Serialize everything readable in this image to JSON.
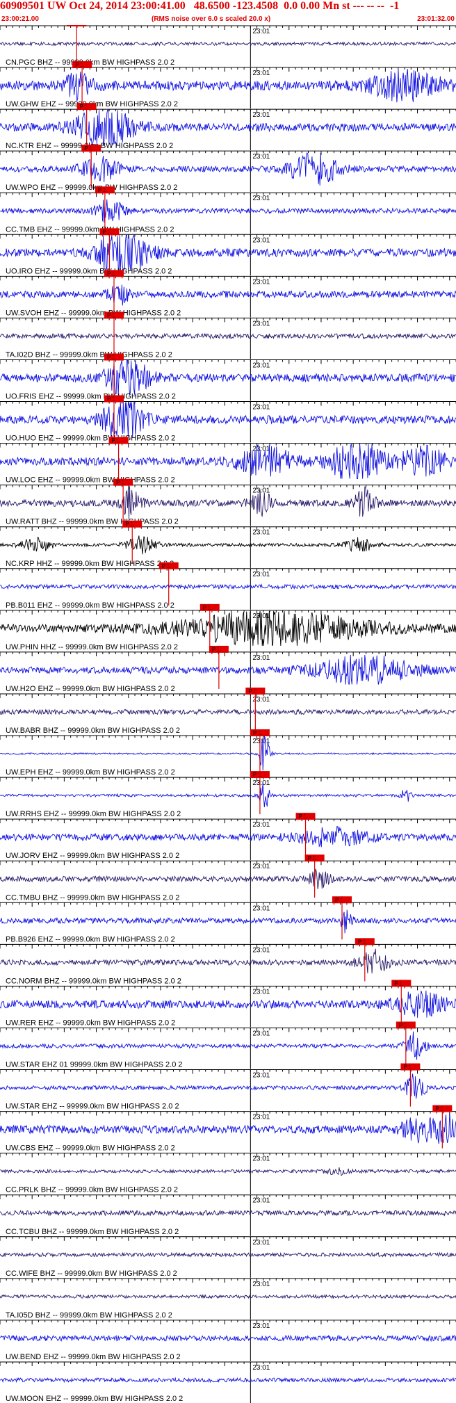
{
  "header": {
    "title": "60909501 UW Oct 24, 2014 23:00:41.00   48.6500 -123.4508  0.0 0.00 Mn st --- -- --  -1",
    "start_time": "23:00:21.00",
    "note": "(RMS noise over 6.0 s scaled 20.0 x)",
    "end_time": "23:01:32.00"
  },
  "colors": {
    "trace_blue": "#1010e0",
    "trace_navy": "#2a1a6a",
    "trace_black": "#000000",
    "pick": "#e00000",
    "grid": "#000000"
  },
  "chart_data": {
    "type": "seismogram",
    "time_axis": {
      "start": "23:00:21.00",
      "end": "23:01:32.00",
      "minute_label": "23:01"
    },
    "pick_label": "P 1",
    "channels": [
      {
        "label": "CN.PGC BHZ -- 99999.0km BW  HIGHPASS  2.0  2",
        "color": "navy",
        "noise": 0.12,
        "pick": 0.168,
        "events": []
      },
      {
        "label": "UW.GHW EHZ -- 99999.0km BW  HIGHPASS  2.0  2",
        "color": "blue",
        "noise": 0.35,
        "pick": 0.18,
        "events": [
          {
            "t": 0.17,
            "w": 0.03,
            "a": 0.8
          },
          {
            "t": 0.89,
            "w": 0.07,
            "a": 1.0
          }
        ]
      },
      {
        "label": "NC.KTR EHZ -- 99999.0km BW  HIGHPASS  2.0  2",
        "color": "blue",
        "noise": 0.3,
        "pick": 0.19,
        "events": [
          {
            "t": 0.23,
            "w": 0.06,
            "a": 1.4
          }
        ]
      },
      {
        "label": "UW.WPO EHZ -- 99999.0km BW  HIGHPASS  2.0  2",
        "color": "blue",
        "noise": 0.22,
        "pick": 0.2,
        "events": [
          {
            "t": 0.22,
            "w": 0.04,
            "a": 0.8
          },
          {
            "t": 0.69,
            "w": 0.05,
            "a": 1.1
          }
        ]
      },
      {
        "label": "CC.TMB EHZ -- 99999.0km BW  HIGHPASS  2.0  2",
        "color": "blue",
        "noise": 0.18,
        "pick": 0.23,
        "events": [
          {
            "t": 0.24,
            "w": 0.03,
            "a": 0.8
          }
        ]
      },
      {
        "label": "UO.IRO EHZ -- 99999.0km BW  HIGHPASS  2.0  2",
        "color": "blue",
        "noise": 0.3,
        "pick": 0.24,
        "events": [
          {
            "t": 0.27,
            "w": 0.05,
            "a": 2.0
          }
        ]
      },
      {
        "label": "UW.SVOH EHZ -- 99999.0km BW  HIGHPASS  2.0  2",
        "color": "blue",
        "noise": 0.25,
        "pick": 0.25,
        "events": [
          {
            "t": 0.26,
            "w": 0.02,
            "a": 0.7
          }
        ]
      },
      {
        "label": "TA.I02D BHZ -- 99999.0km BW  HIGHPASS  2.0  2",
        "color": "navy",
        "noise": 0.18,
        "pick": 0.25,
        "events": []
      },
      {
        "label": "UO.FRIS EHZ -- 99999.0km BW  HIGHPASS  2.0  2",
        "color": "blue",
        "noise": 0.3,
        "pick": 0.25,
        "events": [
          {
            "t": 0.28,
            "w": 0.04,
            "a": 1.6
          }
        ]
      },
      {
        "label": "UO.HUO EHZ -- 99999.0km BW  HIGHPASS  2.0  2",
        "color": "blue",
        "noise": 0.3,
        "pick": 0.25,
        "events": [
          {
            "t": 0.27,
            "w": 0.04,
            "a": 1.6
          }
        ]
      },
      {
        "label": "UW.LOC EHZ -- 99999.0km BW  HIGHPASS  2.0  2",
        "color": "blue",
        "noise": 0.3,
        "pick": 0.26,
        "events": [
          {
            "t": 0.58,
            "w": 0.06,
            "a": 1.0
          },
          {
            "t": 0.78,
            "w": 0.05,
            "a": 1.6
          },
          {
            "t": 0.93,
            "w": 0.05,
            "a": 1.0
          }
        ]
      },
      {
        "label": "UW.RATT BHZ -- 99999.0km BW  HIGHPASS  2.0  2",
        "color": "navy",
        "noise": 0.25,
        "pick": 0.27,
        "events": [
          {
            "t": 0.29,
            "w": 0.02,
            "a": 1.2
          },
          {
            "t": 0.57,
            "w": 0.02,
            "a": 1.1
          },
          {
            "t": 0.8,
            "w": 0.02,
            "a": 1.0
          }
        ]
      },
      {
        "label": "NC.KRP HHZ -- 99999.0km BW  HIGHPASS  2.0  2",
        "color": "black",
        "noise": 0.12,
        "pick": 0.29,
        "events": [
          {
            "t": 0.08,
            "w": 0.03,
            "a": 0.5
          },
          {
            "t": 0.31,
            "w": 0.03,
            "a": 0.6
          },
          {
            "t": 0.79,
            "w": 0.03,
            "a": 0.5
          }
        ]
      },
      {
        "label": "PB.B011 EHZ -- 99999.0km BW  HIGHPASS  2.0  2",
        "color": "blue",
        "noise": 0.15,
        "pick": 0.37,
        "events": []
      },
      {
        "label": "UW.PHIN HHZ -- 99999.0km BW  HIGHPASS  2.0  2",
        "color": "black",
        "noise": 0.3,
        "pick": 0.46,
        "events": [
          {
            "t": 0.6,
            "w": 0.18,
            "a": 1.2
          }
        ]
      },
      {
        "label": "UW.H2O EHZ -- 99999.0km BW  HIGHPASS  2.0  2",
        "color": "blue",
        "noise": 0.25,
        "pick": 0.48,
        "events": [
          {
            "t": 0.8,
            "w": 0.1,
            "a": 1.0
          }
        ]
      },
      {
        "label": "UW.BABR BHZ -- 99999.0km BW  HIGHPASS  2.0  2",
        "color": "navy",
        "noise": 0.18,
        "pick": 0.56,
        "events": []
      },
      {
        "label": "UW.EPH EHZ -- 99999.0km BW  HIGHPASS  2.0  2",
        "color": "blue",
        "noise": 0.06,
        "pick": 0.57,
        "events": [
          {
            "t": 0.58,
            "w": 0.01,
            "a": 1.5
          }
        ]
      },
      {
        "label": "UW.RRHS EHZ -- 99999.0km BW  HIGHPASS  2.0  2",
        "color": "blue",
        "noise": 0.1,
        "pick": 0.57,
        "events": [
          {
            "t": 0.58,
            "w": 0.01,
            "a": 1.0
          },
          {
            "t": 0.89,
            "w": 0.01,
            "a": 0.5
          }
        ]
      },
      {
        "label": "UW.JORV EHZ -- 99999.0km BW  HIGHPASS  2.0  2",
        "color": "blue",
        "noise": 0.25,
        "pick": 0.67,
        "events": [
          {
            "t": 0.73,
            "w": 0.07,
            "a": 0.6
          }
        ]
      },
      {
        "label": "CC.TMBU BHZ -- 99999.0km BW  HIGHPASS  2.0  2",
        "color": "navy",
        "noise": 0.2,
        "pick": 0.69,
        "events": [
          {
            "t": 0.7,
            "w": 0.02,
            "a": 0.7
          }
        ]
      },
      {
        "label": "PB.B926 EHZ -- 99999.0km BW  HIGHPASS  2.0  2",
        "color": "blue",
        "noise": 0.2,
        "pick": 0.75,
        "events": [
          {
            "t": 0.76,
            "w": 0.01,
            "a": 1.2
          }
        ]
      },
      {
        "label": "CC.NORM BHZ -- 99999.0km BW  HIGHPASS  2.0  2",
        "color": "navy",
        "noise": 0.2,
        "pick": 0.8,
        "events": [
          {
            "t": 0.82,
            "w": 0.03,
            "a": 1.0
          }
        ]
      },
      {
        "label": "UW.RER EHZ -- 99999.0km BW  HIGHPASS  2.0  2",
        "color": "blue",
        "noise": 0.3,
        "pick": 0.88,
        "events": [
          {
            "t": 0.92,
            "w": 0.05,
            "a": 0.8
          }
        ]
      },
      {
        "label": "UW.STAR EHZ 01 99999.0km BW  HIGHPASS  2.0  2",
        "color": "blue",
        "noise": 0.15,
        "pick": 0.89,
        "events": [
          {
            "t": 0.91,
            "w": 0.02,
            "a": 1.0
          }
        ]
      },
      {
        "label": "UW.STAR EHZ -- 99999.0km BW  HIGHPASS  2.0  2",
        "color": "blue",
        "noise": 0.15,
        "pick": 0.9,
        "events": [
          {
            "t": 0.91,
            "w": 0.02,
            "a": 1.0
          }
        ]
      },
      {
        "label": "UW.CBS EHZ -- 99999.0km BW  HIGHPASS  2.0  2",
        "color": "blue",
        "noise": 0.3,
        "pick": 0.97,
        "events": [
          {
            "t": 0.92,
            "w": 0.04,
            "a": 0.8
          },
          {
            "t": 0.98,
            "w": 0.02,
            "a": 1.2
          }
        ]
      },
      {
        "label": "CC.PRLK BHZ -- 99999.0km BW  HIGHPASS  2.0  2",
        "color": "navy",
        "noise": 0.12,
        "pick": null,
        "events": [
          {
            "t": 0.74,
            "w": 0.02,
            "a": 0.3
          }
        ]
      },
      {
        "label": "CC.TCBU BHZ -- 99999.0km BW  HIGHPASS  2.0  2",
        "color": "navy",
        "noise": 0.18,
        "pick": null,
        "events": []
      },
      {
        "label": "CC.WIFE BHZ -- 99999.0km BW  HIGHPASS  2.0  2",
        "color": "navy",
        "noise": 0.14,
        "pick": null,
        "events": []
      },
      {
        "label": "TA.I05D BHZ -- 99999.0km BW  HIGHPASS  2.0  2",
        "color": "navy",
        "noise": 0.12,
        "pick": null,
        "events": []
      },
      {
        "label": "UW.BEND EHZ -- 99999.0km BW  HIGHPASS  2.0  2",
        "color": "blue",
        "noise": 0.2,
        "pick": null,
        "events": []
      },
      {
        "label": "UW.MOON EHZ -- 99999.0km BW  HIGHPASS  2.0  2",
        "color": "blue",
        "noise": 0.15,
        "pick": null,
        "events": []
      }
    ]
  }
}
